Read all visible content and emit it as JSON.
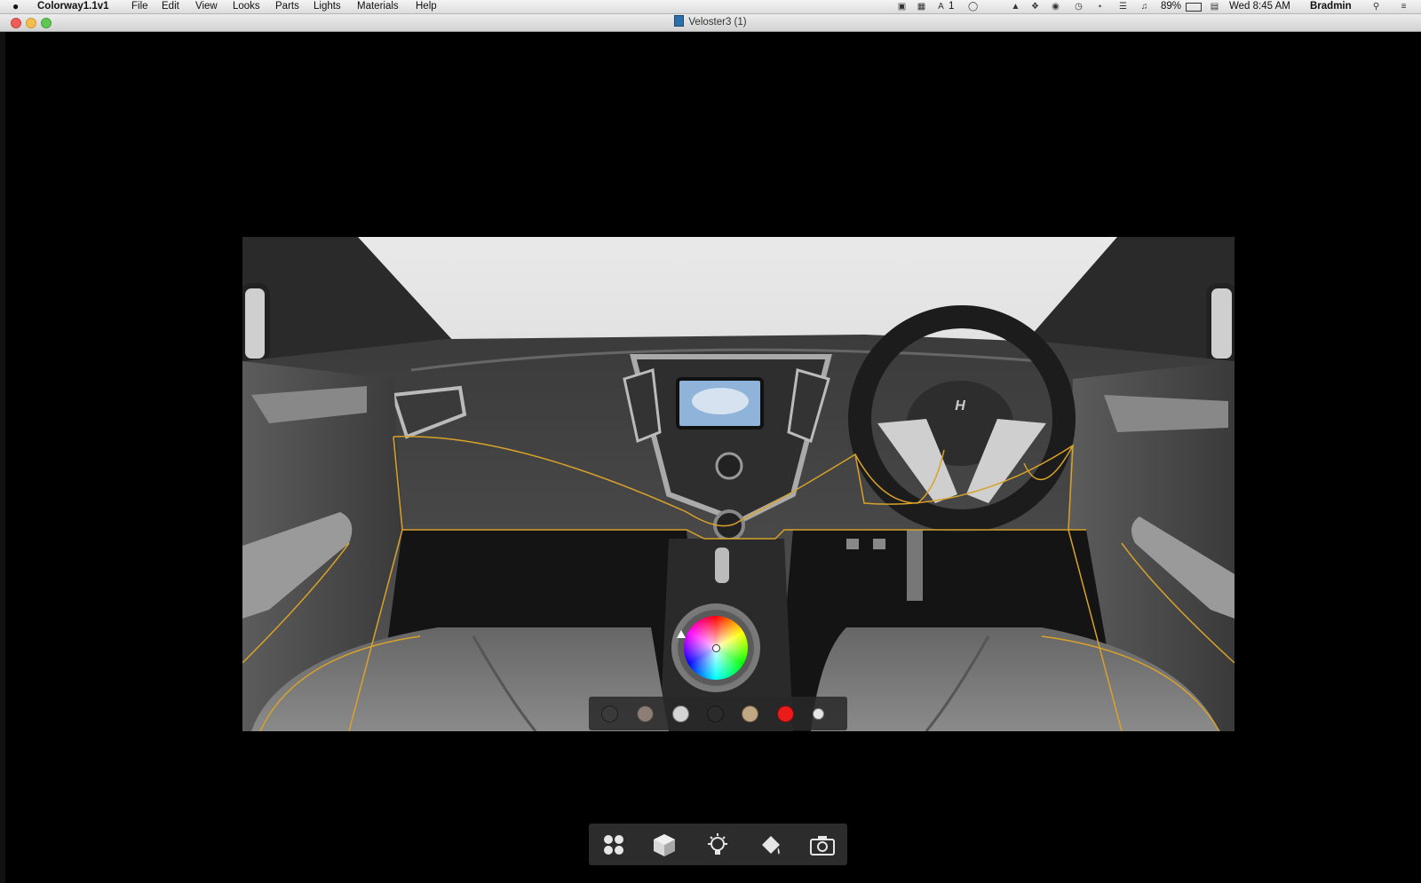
{
  "menubar": {
    "app_name": "Colorway1.1v1",
    "menus": [
      "File",
      "Edit",
      "View",
      "Looks",
      "Parts",
      "Lights",
      "Materials",
      "Help"
    ],
    "status": {
      "bt_label": "1",
      "battery": "89%",
      "clock": "Wed 8:45 AM",
      "user": "Bradmin"
    }
  },
  "window": {
    "title": "Veloster3 (1)"
  },
  "scene": {
    "steering_logo": "HYUNDAI"
  },
  "swatches": [
    {
      "name": "dark-gray",
      "color": "#3a3a3a"
    },
    {
      "name": "warm-gray",
      "color": "#8c7d76"
    },
    {
      "name": "light-gray",
      "color": "#d4d4d4"
    },
    {
      "name": "charcoal",
      "color": "#2b2b2b"
    },
    {
      "name": "tan",
      "color": "#c2a882"
    },
    {
      "name": "red",
      "color": "#ec1b1b"
    },
    {
      "name": "white",
      "color": "#e6e6e6"
    }
  ],
  "toolbar": [
    {
      "name": "looks-tool",
      "icon": "grid-icon"
    },
    {
      "name": "parts-tool",
      "icon": "cube-icon"
    },
    {
      "name": "lights-tool",
      "icon": "lightbulb-icon"
    },
    {
      "name": "materials-tool",
      "icon": "paint-bucket-icon"
    },
    {
      "name": "snapshot-tool",
      "icon": "camera-icon"
    }
  ],
  "colors": {
    "accent_outline": "#d8a22a",
    "toolbar_bg": "#2c2c2c"
  }
}
